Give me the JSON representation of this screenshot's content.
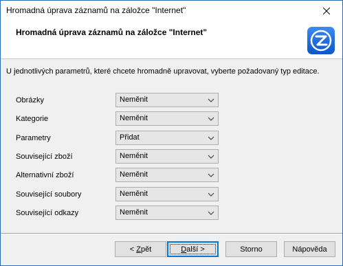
{
  "window": {
    "title": "Hromadná úprava záznamů na záložce \"Internet\""
  },
  "header": {
    "title": "Hromadná úprava záznamů na záložce \"Internet\"",
    "logo_icon": "app-logo-z-icon",
    "accent_color": "#1a73e8"
  },
  "instruction": "U jednotlivých parametrů, které chcete hromadně upravovat, vyberte požadovaný typ editace.",
  "rows": [
    {
      "label": "Obrázky",
      "value": "Neměnit"
    },
    {
      "label": "Kategorie",
      "value": "Neměnit"
    },
    {
      "label": "Parametry",
      "value": "Přidat"
    },
    {
      "label": "Související zboží",
      "value": "Neměnit"
    },
    {
      "label": "Alternativní zboží",
      "value": "Neměnit"
    },
    {
      "label": "Související soubory",
      "value": "Neměnit"
    },
    {
      "label": "Související odkazy",
      "value": "Neměnit"
    }
  ],
  "buttons": {
    "back_prefix": "< ",
    "back_mnemonic": "Z",
    "back_rest": "pět",
    "next_mnemonic": "D",
    "next_rest": "alší >",
    "cancel": "Storno",
    "help": "Nápověda"
  }
}
